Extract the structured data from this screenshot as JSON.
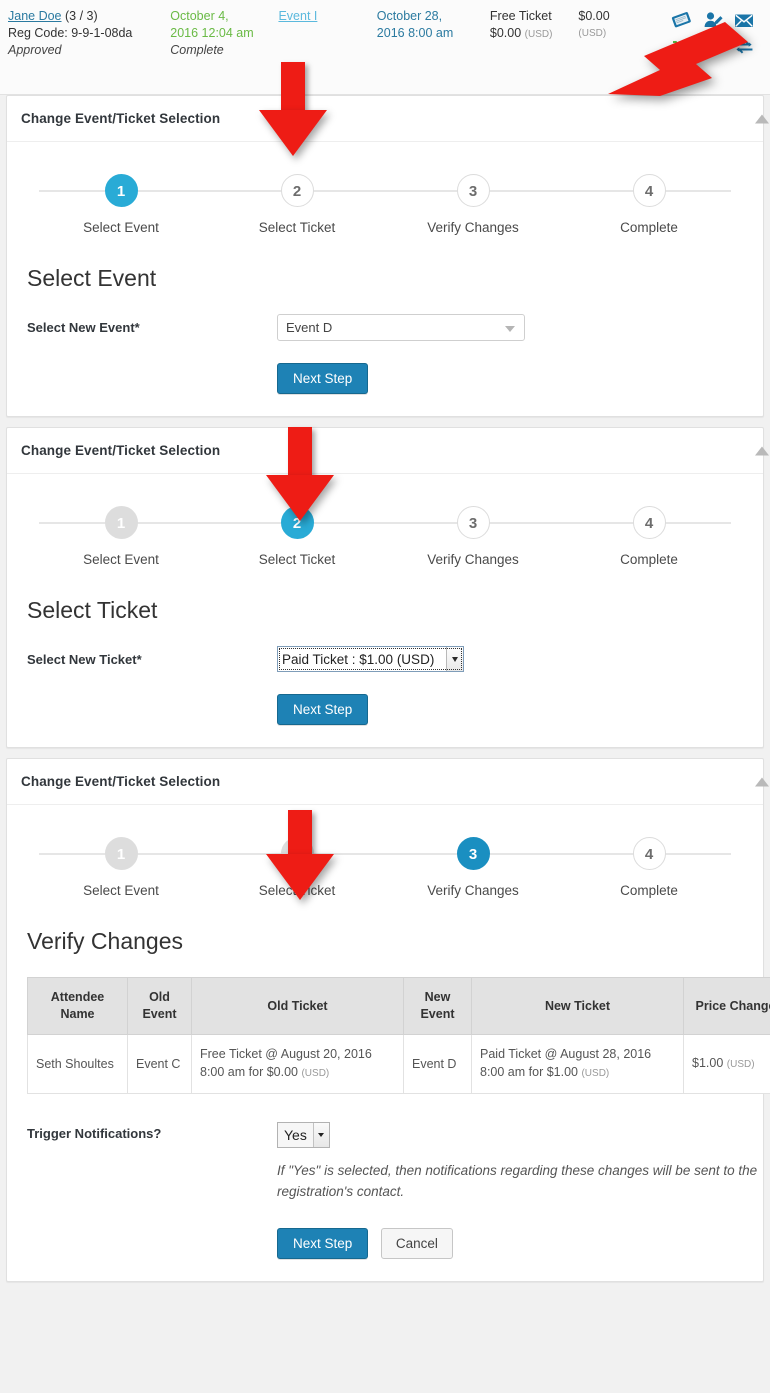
{
  "registration_header": {
    "attendee_name": "Jane Doe",
    "attendee_count": "(3 / 3)",
    "reg_code_label": "Reg Code: 9-9-1-08da",
    "status": "Approved",
    "reg_date_line1": "October 4,",
    "reg_date_line2": "2016 12:04 am",
    "reg_status": "Complete",
    "event_name": "Event I",
    "event_date_line1": "October 28,",
    "event_date_line2": "2016 8:00 am",
    "ticket_name": "Free Ticket",
    "ticket_price": "$0.00",
    "ticket_currency": "(USD)",
    "paid_amount": "$0.00",
    "paid_currency": "(USD)",
    "icons": [
      {
        "name": "ticket-icon",
        "title": "View Tickets"
      },
      {
        "name": "edit-attendee-icon",
        "title": "Edit Attendee"
      },
      {
        "name": "email-icon",
        "title": "Send Email"
      },
      {
        "name": "cart-icon",
        "title": "View Transaction"
      },
      {
        "name": "pending-clock-icon",
        "title": "Pending"
      },
      {
        "name": "exchange-icon",
        "title": "Change Event/Ticket"
      }
    ]
  },
  "panels": [
    {
      "title": "Change Event/Ticket Selection",
      "steps": [
        {
          "number": "1",
          "label": "Select Event",
          "state": "active"
        },
        {
          "number": "2",
          "label": "Select Ticket",
          "state": "todo"
        },
        {
          "number": "3",
          "label": "Verify Changes",
          "state": "todo"
        },
        {
          "number": "4",
          "label": "Complete",
          "state": "todo"
        }
      ],
      "heading": "Select Event",
      "field_label": "Select New Event*",
      "field_value": "Event D",
      "next_label": "Next Step"
    },
    {
      "title": "Change Event/Ticket Selection",
      "steps": [
        {
          "number": "1",
          "label": "Select Event",
          "state": "done"
        },
        {
          "number": "2",
          "label": "Select Ticket",
          "state": "active"
        },
        {
          "number": "3",
          "label": "Verify Changes",
          "state": "todo"
        },
        {
          "number": "4",
          "label": "Complete",
          "state": "todo"
        }
      ],
      "heading": "Select Ticket",
      "field_label": "Select New Ticket*",
      "field_value": "Paid Ticket : $1.00 (USD)",
      "next_label": "Next Step"
    },
    {
      "title": "Change Event/Ticket Selection",
      "steps": [
        {
          "number": "1",
          "label": "Select Event",
          "state": "done"
        },
        {
          "number": "2",
          "label": "Select Ticket",
          "state": "done"
        },
        {
          "number": "3",
          "label": "Verify Changes",
          "state": "active-deep"
        },
        {
          "number": "4",
          "label": "Complete",
          "state": "todo"
        }
      ],
      "heading": "Verify Changes",
      "table": {
        "headers": [
          "Attendee Name",
          "Old Event",
          "Old Ticket",
          "New Event",
          "New Ticket",
          "Price Change"
        ],
        "rows": [
          {
            "attendee_name": "Seth Shoultes",
            "old_event": "Event C",
            "old_ticket": "Free Ticket @ August 20, 2016 8:00 am for $0.00",
            "old_ticket_currency": "(USD)",
            "new_event": "Event D",
            "new_ticket": "Paid Ticket @ August 28, 2016 8:00 am for $1.00",
            "new_ticket_currency": "(USD)",
            "price_change": "$1.00",
            "price_currency": "(USD)"
          }
        ]
      },
      "notifications_label": "Trigger Notifications?",
      "notifications_value": "Yes",
      "notifications_help": "If \"Yes\" is selected, then notifications regarding these changes will be sent to the registration's contact.",
      "next_label": "Next Step",
      "cancel_label": "Cancel"
    }
  ],
  "colors": {
    "accent_blue": "#29abd6",
    "accent_blue_deep": "#1a8fc1",
    "button_blue": "#1e82b5",
    "arrow_red": "#ee1c15",
    "green_status": "#6aba45",
    "step_done_gray": "#dddddd"
  }
}
